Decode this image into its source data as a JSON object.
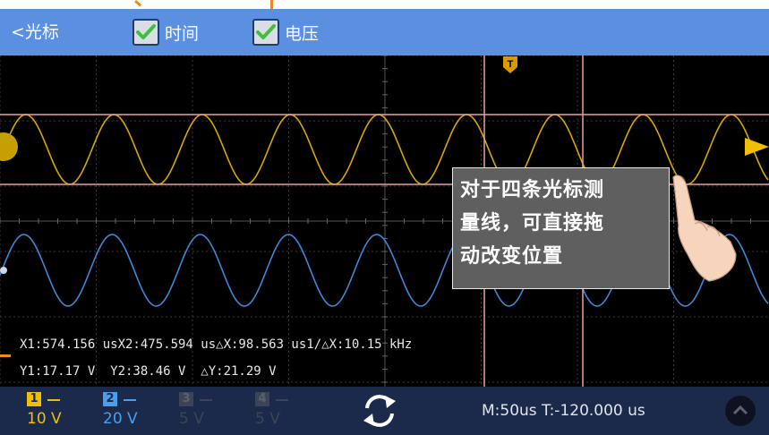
{
  "header": {
    "back_label": "<光标",
    "checkboxes": [
      {
        "label": "时间",
        "checked": true
      },
      {
        "label": "电压",
        "checked": true
      }
    ]
  },
  "readouts": {
    "line1": "X1:574.156 usX2:475.594 us△X:98.563 us1/△X:10.15 kHz",
    "line2": "Y1:17.17 V  Y2:38.46 V  △Y:21.29 V"
  },
  "tooltip": {
    "line1": "对于四条光标测",
    "line2": "量线，可直接拖",
    "line3": "动改变位置"
  },
  "trigger_marker": "T",
  "channels": [
    {
      "number": "1",
      "scale": "10 V",
      "color": "#f0c000",
      "enabled": true
    },
    {
      "number": "2",
      "scale": "20 V",
      "color": "#4a9ef0",
      "enabled": true
    },
    {
      "number": "3",
      "scale": "5 V",
      "color": "#5a6272",
      "enabled": false
    },
    {
      "number": "4",
      "scale": "5 V",
      "color": "#5a6272",
      "enabled": false
    }
  ],
  "timebase": "M:50us  T:-120.000 us",
  "icons": [
    "checkmark-icon",
    "rotate-icon",
    "menu-icon",
    "trigger-icon",
    "hand-pointer-icon"
  ],
  "colors": {
    "header_bg": "#5b8fe0",
    "screen_bg": "#000000",
    "ch1": "#f0c000",
    "ch2": "#4a9ef0",
    "cursor_line": "#e8a0a0",
    "bottom_bar": "#1b2a4a",
    "callout": "#f28a1b"
  }
}
